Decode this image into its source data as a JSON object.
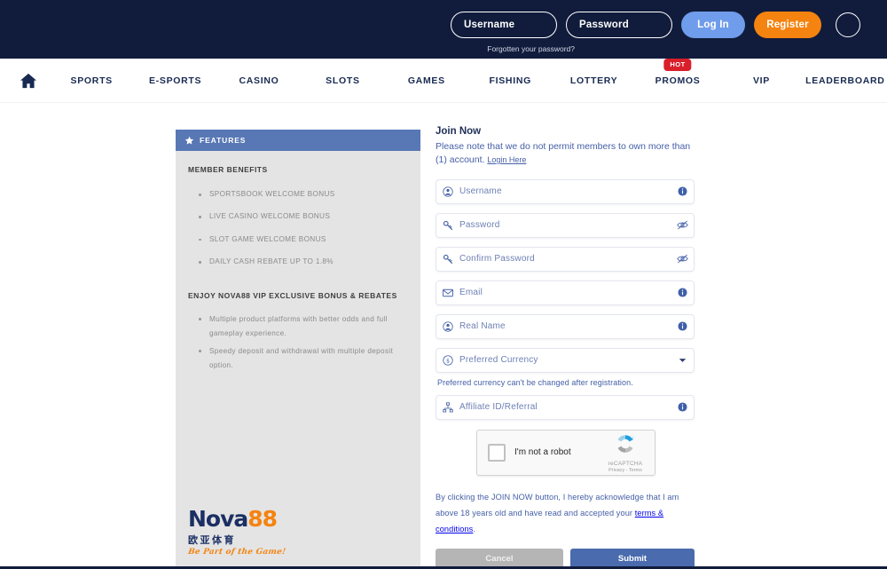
{
  "header": {
    "username_placeholder": "Username",
    "password_placeholder": "Password",
    "login_label": "Log In",
    "register_label": "Register",
    "forgot_label": "Forgotten your password?",
    "accent_blue": "#6f9ceb",
    "accent_orange": "#f5830f",
    "bar_bg": "#111c3c"
  },
  "nav": {
    "items": [
      {
        "label": "SPORTS"
      },
      {
        "label": "E-SPORTS"
      },
      {
        "label": "CASINO"
      },
      {
        "label": "SLOTS"
      },
      {
        "label": "GAMES"
      },
      {
        "label": "FISHING"
      },
      {
        "label": "LOTTERY"
      },
      {
        "label": "PROMOS",
        "badge": "HOT"
      },
      {
        "label": "VIP"
      },
      {
        "label": "LEADERBOARD"
      }
    ],
    "badge_color": "#d81f2a"
  },
  "features": {
    "header_label": "FEATURES",
    "header_bg": "#5877b5",
    "panel_bg": "#e4e4e4",
    "section_one_title": "MEMBER BENEFITS",
    "benefits": [
      "SPORTSBOOK WELCOME BONUS",
      "LIVE CASINO WELCOME BONUS",
      "SLOT GAME WELCOME BONUS",
      "DAILY CASH REBATE UP TO 1.8%"
    ],
    "section_two_title": "ENJOY NOVA88 VIP EXCLUSIVE BONUS & REBATES",
    "vip_points": [
      "Multiple product platforms with better odds and full gameplay experience.",
      "Speedy deposit and withdrawal with multiple deposit option."
    ],
    "logo": {
      "name_primary": "Nova",
      "name_accent": "88",
      "chinese": "欧亚体育",
      "tagline": "Be Part of the Game!"
    }
  },
  "form": {
    "title": "Join Now",
    "note": "Please note that we do not permit members to own more than (1) account.",
    "login_here": "Login Here",
    "fields": [
      {
        "placeholder": "Username",
        "lead_icon": "user-icon",
        "trail_icon": "info-icon"
      },
      {
        "placeholder": "Password",
        "lead_icon": "key-icon",
        "trail_icon": "eye-slash-icon"
      },
      {
        "placeholder": "Confirm Password",
        "lead_icon": "key-icon",
        "trail_icon": "eye-slash-icon"
      },
      {
        "placeholder": "Email",
        "lead_icon": "envelope-icon",
        "trail_icon": "info-icon"
      },
      {
        "placeholder": "Real Name",
        "lead_icon": "user-icon",
        "trail_icon": "info-icon"
      },
      {
        "placeholder": "Preferred Currency",
        "lead_icon": "currency-icon",
        "trail_icon": "chevron-down-icon"
      },
      {
        "placeholder": "Affiliate ID/Referral",
        "lead_icon": "network-icon",
        "trail_icon": "info-icon"
      }
    ],
    "currency_hint": "Preferred currency can't be changed after registration.",
    "recaptcha": {
      "label": "I'm not a robot",
      "brand": "reCAPTCHA",
      "terms": "Privacy - Terms"
    },
    "terms_text_a": "By clicking the JOIN NOW button, I hereby acknowledge that I am above 18 years old and have read and accepted your ",
    "terms_link": "terms & conditions",
    "terms_text_b": ".",
    "cancel_label": "Cancel",
    "submit_label": "Submit",
    "submit_color": "#4a6bad"
  }
}
